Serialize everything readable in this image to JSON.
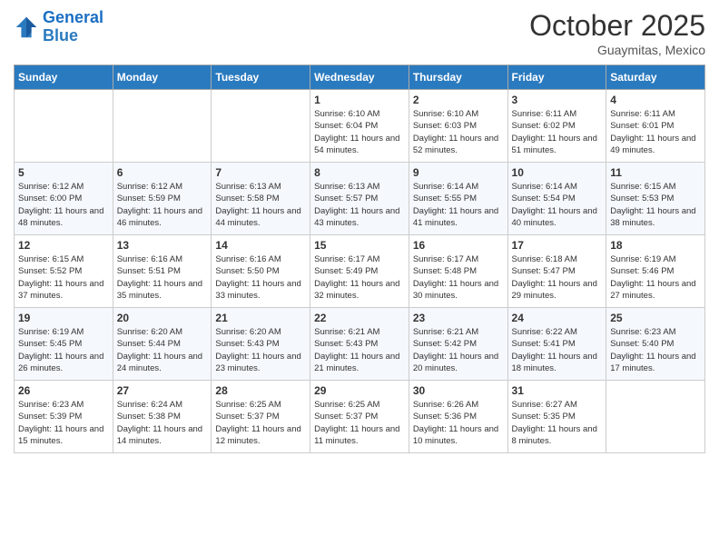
{
  "header": {
    "logo_line1": "General",
    "logo_line2": "Blue",
    "month_title": "October 2025",
    "location": "Guaymitas, Mexico"
  },
  "weekdays": [
    "Sunday",
    "Monday",
    "Tuesday",
    "Wednesday",
    "Thursday",
    "Friday",
    "Saturday"
  ],
  "weeks": [
    [
      {
        "day": "",
        "sunrise": "",
        "sunset": "",
        "daylight": ""
      },
      {
        "day": "",
        "sunrise": "",
        "sunset": "",
        "daylight": ""
      },
      {
        "day": "",
        "sunrise": "",
        "sunset": "",
        "daylight": ""
      },
      {
        "day": "1",
        "sunrise": "Sunrise: 6:10 AM",
        "sunset": "Sunset: 6:04 PM",
        "daylight": "Daylight: 11 hours and 54 minutes."
      },
      {
        "day": "2",
        "sunrise": "Sunrise: 6:10 AM",
        "sunset": "Sunset: 6:03 PM",
        "daylight": "Daylight: 11 hours and 52 minutes."
      },
      {
        "day": "3",
        "sunrise": "Sunrise: 6:11 AM",
        "sunset": "Sunset: 6:02 PM",
        "daylight": "Daylight: 11 hours and 51 minutes."
      },
      {
        "day": "4",
        "sunrise": "Sunrise: 6:11 AM",
        "sunset": "Sunset: 6:01 PM",
        "daylight": "Daylight: 11 hours and 49 minutes."
      }
    ],
    [
      {
        "day": "5",
        "sunrise": "Sunrise: 6:12 AM",
        "sunset": "Sunset: 6:00 PM",
        "daylight": "Daylight: 11 hours and 48 minutes."
      },
      {
        "day": "6",
        "sunrise": "Sunrise: 6:12 AM",
        "sunset": "Sunset: 5:59 PM",
        "daylight": "Daylight: 11 hours and 46 minutes."
      },
      {
        "day": "7",
        "sunrise": "Sunrise: 6:13 AM",
        "sunset": "Sunset: 5:58 PM",
        "daylight": "Daylight: 11 hours and 44 minutes."
      },
      {
        "day": "8",
        "sunrise": "Sunrise: 6:13 AM",
        "sunset": "Sunset: 5:57 PM",
        "daylight": "Daylight: 11 hours and 43 minutes."
      },
      {
        "day": "9",
        "sunrise": "Sunrise: 6:14 AM",
        "sunset": "Sunset: 5:55 PM",
        "daylight": "Daylight: 11 hours and 41 minutes."
      },
      {
        "day": "10",
        "sunrise": "Sunrise: 6:14 AM",
        "sunset": "Sunset: 5:54 PM",
        "daylight": "Daylight: 11 hours and 40 minutes."
      },
      {
        "day": "11",
        "sunrise": "Sunrise: 6:15 AM",
        "sunset": "Sunset: 5:53 PM",
        "daylight": "Daylight: 11 hours and 38 minutes."
      }
    ],
    [
      {
        "day": "12",
        "sunrise": "Sunrise: 6:15 AM",
        "sunset": "Sunset: 5:52 PM",
        "daylight": "Daylight: 11 hours and 37 minutes."
      },
      {
        "day": "13",
        "sunrise": "Sunrise: 6:16 AM",
        "sunset": "Sunset: 5:51 PM",
        "daylight": "Daylight: 11 hours and 35 minutes."
      },
      {
        "day": "14",
        "sunrise": "Sunrise: 6:16 AM",
        "sunset": "Sunset: 5:50 PM",
        "daylight": "Daylight: 11 hours and 33 minutes."
      },
      {
        "day": "15",
        "sunrise": "Sunrise: 6:17 AM",
        "sunset": "Sunset: 5:49 PM",
        "daylight": "Daylight: 11 hours and 32 minutes."
      },
      {
        "day": "16",
        "sunrise": "Sunrise: 6:17 AM",
        "sunset": "Sunset: 5:48 PM",
        "daylight": "Daylight: 11 hours and 30 minutes."
      },
      {
        "day": "17",
        "sunrise": "Sunrise: 6:18 AM",
        "sunset": "Sunset: 5:47 PM",
        "daylight": "Daylight: 11 hours and 29 minutes."
      },
      {
        "day": "18",
        "sunrise": "Sunrise: 6:19 AM",
        "sunset": "Sunset: 5:46 PM",
        "daylight": "Daylight: 11 hours and 27 minutes."
      }
    ],
    [
      {
        "day": "19",
        "sunrise": "Sunrise: 6:19 AM",
        "sunset": "Sunset: 5:45 PM",
        "daylight": "Daylight: 11 hours and 26 minutes."
      },
      {
        "day": "20",
        "sunrise": "Sunrise: 6:20 AM",
        "sunset": "Sunset: 5:44 PM",
        "daylight": "Daylight: 11 hours and 24 minutes."
      },
      {
        "day": "21",
        "sunrise": "Sunrise: 6:20 AM",
        "sunset": "Sunset: 5:43 PM",
        "daylight": "Daylight: 11 hours and 23 minutes."
      },
      {
        "day": "22",
        "sunrise": "Sunrise: 6:21 AM",
        "sunset": "Sunset: 5:43 PM",
        "daylight": "Daylight: 11 hours and 21 minutes."
      },
      {
        "day": "23",
        "sunrise": "Sunrise: 6:21 AM",
        "sunset": "Sunset: 5:42 PM",
        "daylight": "Daylight: 11 hours and 20 minutes."
      },
      {
        "day": "24",
        "sunrise": "Sunrise: 6:22 AM",
        "sunset": "Sunset: 5:41 PM",
        "daylight": "Daylight: 11 hours and 18 minutes."
      },
      {
        "day": "25",
        "sunrise": "Sunrise: 6:23 AM",
        "sunset": "Sunset: 5:40 PM",
        "daylight": "Daylight: 11 hours and 17 minutes."
      }
    ],
    [
      {
        "day": "26",
        "sunrise": "Sunrise: 6:23 AM",
        "sunset": "Sunset: 5:39 PM",
        "daylight": "Daylight: 11 hours and 15 minutes."
      },
      {
        "day": "27",
        "sunrise": "Sunrise: 6:24 AM",
        "sunset": "Sunset: 5:38 PM",
        "daylight": "Daylight: 11 hours and 14 minutes."
      },
      {
        "day": "28",
        "sunrise": "Sunrise: 6:25 AM",
        "sunset": "Sunset: 5:37 PM",
        "daylight": "Daylight: 11 hours and 12 minutes."
      },
      {
        "day": "29",
        "sunrise": "Sunrise: 6:25 AM",
        "sunset": "Sunset: 5:37 PM",
        "daylight": "Daylight: 11 hours and 11 minutes."
      },
      {
        "day": "30",
        "sunrise": "Sunrise: 6:26 AM",
        "sunset": "Sunset: 5:36 PM",
        "daylight": "Daylight: 11 hours and 10 minutes."
      },
      {
        "day": "31",
        "sunrise": "Sunrise: 6:27 AM",
        "sunset": "Sunset: 5:35 PM",
        "daylight": "Daylight: 11 hours and 8 minutes."
      },
      {
        "day": "",
        "sunrise": "",
        "sunset": "",
        "daylight": ""
      }
    ]
  ]
}
